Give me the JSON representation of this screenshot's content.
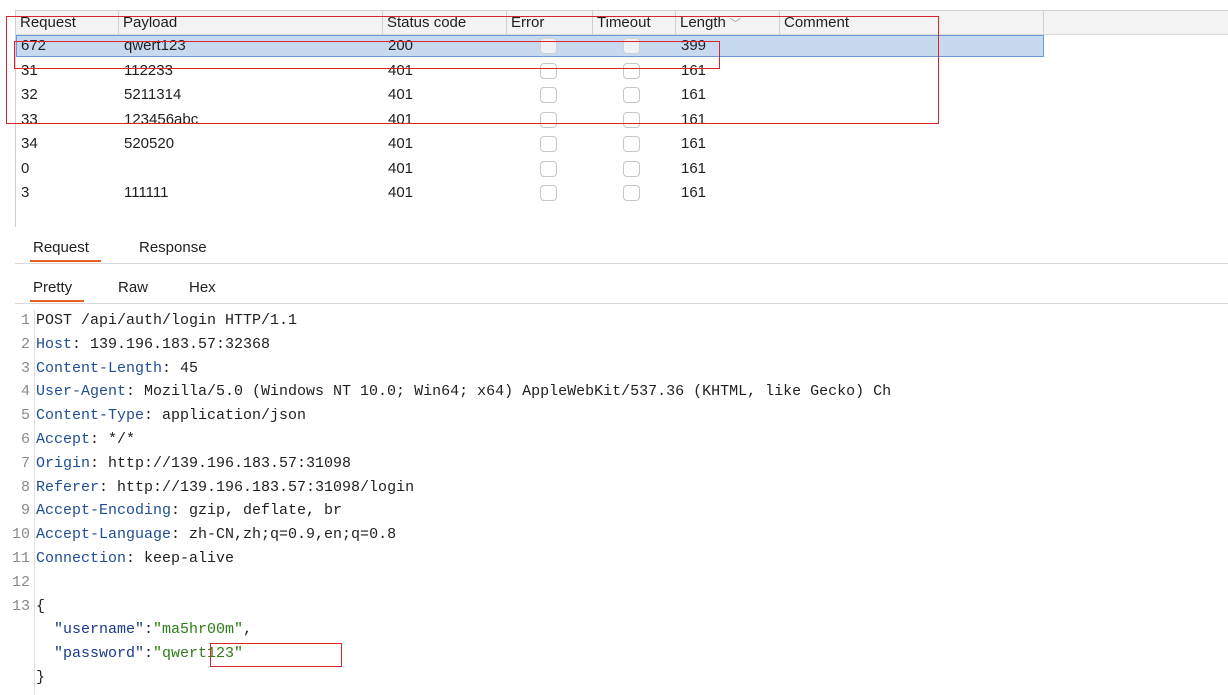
{
  "table": {
    "columns": [
      {
        "label": "Request"
      },
      {
        "label": "Payload"
      },
      {
        "label": "Status code"
      },
      {
        "label": "Error"
      },
      {
        "label": "Timeout"
      },
      {
        "label": "Length"
      },
      {
        "label": "Comment"
      }
    ],
    "sort_indicator": "﹀",
    "rows": [
      {
        "request": "672",
        "payload": "qwert123",
        "status": "200",
        "length": "399",
        "error": false,
        "timeout": false,
        "selected": true
      },
      {
        "request": "31",
        "payload": "112233",
        "status": "401",
        "length": "161",
        "error": false,
        "timeout": false
      },
      {
        "request": "32",
        "payload": "5211314",
        "status": "401",
        "length": "161",
        "error": false,
        "timeout": false
      },
      {
        "request": "33",
        "payload": "123456abc",
        "status": "401",
        "length": "161",
        "error": false,
        "timeout": false
      },
      {
        "request": "34",
        "payload": "520520",
        "status": "401",
        "length": "161",
        "error": false,
        "timeout": false
      },
      {
        "request": "0",
        "payload": "",
        "status": "401",
        "length": "161",
        "error": false,
        "timeout": false
      },
      {
        "request": "3",
        "payload": "111111",
        "status": "401",
        "length": "161",
        "error": false,
        "timeout": false
      }
    ]
  },
  "tabs": {
    "main": [
      {
        "label": "Request",
        "active": true
      },
      {
        "label": "Response",
        "active": false
      }
    ],
    "view": [
      {
        "label": "Pretty",
        "active": true
      },
      {
        "label": "Raw",
        "active": false
      },
      {
        "label": "Hex",
        "active": false
      }
    ]
  },
  "request": {
    "lines": [
      {
        "n": "1",
        "parts": [
          [
            "POST /api/auth/login HTTP/1.1",
            ""
          ]
        ]
      },
      {
        "n": "2",
        "parts": [
          [
            "Host",
            "hname"
          ],
          [
            ": 139.196.183.57:32368",
            ""
          ]
        ]
      },
      {
        "n": "3",
        "parts": [
          [
            "Content-Length",
            "hname"
          ],
          [
            ": 45",
            ""
          ]
        ]
      },
      {
        "n": "4",
        "parts": [
          [
            "User-Agent",
            "hname"
          ],
          [
            ": Mozilla/5.0 (Windows NT 10.0; Win64; x64) AppleWebKit/537.36 (KHTML, like Gecko) Ch",
            ""
          ]
        ]
      },
      {
        "n": "5",
        "parts": [
          [
            "Content-Type",
            "hname"
          ],
          [
            ": application/json",
            ""
          ]
        ]
      },
      {
        "n": "6",
        "parts": [
          [
            "Accept",
            "hname"
          ],
          [
            ": */*",
            ""
          ]
        ]
      },
      {
        "n": "7",
        "parts": [
          [
            "Origin",
            "hname"
          ],
          [
            ": http://139.196.183.57:31098",
            ""
          ]
        ]
      },
      {
        "n": "8",
        "parts": [
          [
            "Referer",
            "hname"
          ],
          [
            ": http://139.196.183.57:31098/login",
            ""
          ]
        ]
      },
      {
        "n": "9",
        "parts": [
          [
            "Accept-Encoding",
            "hname"
          ],
          [
            ": gzip, deflate, br",
            ""
          ]
        ]
      },
      {
        "n": "10",
        "parts": [
          [
            "Accept-Language",
            "hname"
          ],
          [
            ": zh-CN,zh;q=0.9,en;q=0.8",
            ""
          ]
        ]
      },
      {
        "n": "11",
        "parts": [
          [
            "Connection",
            "hname"
          ],
          [
            ": keep-alive",
            ""
          ]
        ]
      },
      {
        "n": "12",
        "parts": []
      },
      {
        "n": "13",
        "parts": [
          [
            "{",
            ""
          ]
        ]
      },
      {
        "n": "",
        "parts": [
          [
            "  ",
            ""
          ],
          [
            "\"username\"",
            "jkey"
          ],
          [
            ":",
            ""
          ],
          [
            "\"ma5hr00m\"",
            "jstr"
          ],
          [
            ",",
            ""
          ]
        ]
      },
      {
        "n": "",
        "parts": [
          [
            "  ",
            ""
          ],
          [
            "\"password\"",
            "jkey"
          ],
          [
            ":",
            ""
          ],
          [
            "\"qwert123\"",
            "jstr"
          ]
        ]
      },
      {
        "n": "",
        "parts": [
          [
            "}",
            ""
          ]
        ]
      }
    ]
  },
  "colors": {
    "highlight_box": "#d9262c",
    "selected_row": "#c7d9ef",
    "active_tab_underline": "#e8601c",
    "header_name": "#1f4e95",
    "json_key": "#1a3a87",
    "json_string": "#2e7d1a"
  }
}
